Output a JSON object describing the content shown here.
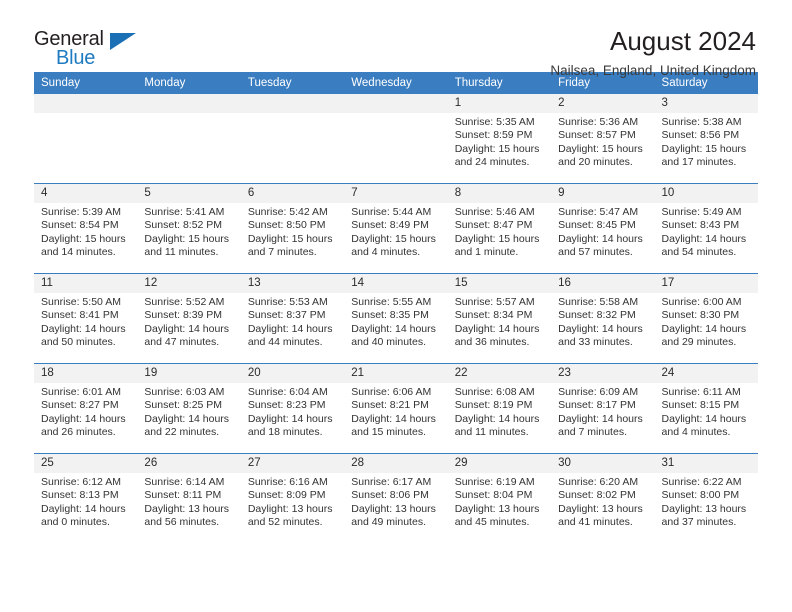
{
  "brand": {
    "name_part1": "General",
    "name_part2": "Blue",
    "logo_icon": "triangle-flag-icon"
  },
  "header": {
    "title": "August 2024",
    "subtitle": "Nailsea, England, United Kingdom"
  },
  "weekday_headers": [
    "Sunday",
    "Monday",
    "Tuesday",
    "Wednesday",
    "Thursday",
    "Friday",
    "Saturday"
  ],
  "colors": {
    "header_blue": "#3a7dc0",
    "brand_blue": "#1f7bc1",
    "daynum_band": "#f2f2f2",
    "text": "#333333"
  },
  "labels": {
    "sunrise_prefix": "Sunrise:",
    "sunset_prefix": "Sunset:",
    "daylight_prefix": "Daylight:"
  },
  "weeks": [
    [
      {
        "day": "",
        "empty": true
      },
      {
        "day": "",
        "empty": true
      },
      {
        "day": "",
        "empty": true
      },
      {
        "day": "",
        "empty": true
      },
      {
        "day": "1",
        "sunrise": "Sunrise: 5:35 AM",
        "sunset": "Sunset: 8:59 PM",
        "daylight_line1": "Daylight: 15 hours",
        "daylight_line2": "and 24 minutes."
      },
      {
        "day": "2",
        "sunrise": "Sunrise: 5:36 AM",
        "sunset": "Sunset: 8:57 PM",
        "daylight_line1": "Daylight: 15 hours",
        "daylight_line2": "and 20 minutes."
      },
      {
        "day": "3",
        "sunrise": "Sunrise: 5:38 AM",
        "sunset": "Sunset: 8:56 PM",
        "daylight_line1": "Daylight: 15 hours",
        "daylight_line2": "and 17 minutes."
      }
    ],
    [
      {
        "day": "4",
        "sunrise": "Sunrise: 5:39 AM",
        "sunset": "Sunset: 8:54 PM",
        "daylight_line1": "Daylight: 15 hours",
        "daylight_line2": "and 14 minutes."
      },
      {
        "day": "5",
        "sunrise": "Sunrise: 5:41 AM",
        "sunset": "Sunset: 8:52 PM",
        "daylight_line1": "Daylight: 15 hours",
        "daylight_line2": "and 11 minutes."
      },
      {
        "day": "6",
        "sunrise": "Sunrise: 5:42 AM",
        "sunset": "Sunset: 8:50 PM",
        "daylight_line1": "Daylight: 15 hours",
        "daylight_line2": "and 7 minutes."
      },
      {
        "day": "7",
        "sunrise": "Sunrise: 5:44 AM",
        "sunset": "Sunset: 8:49 PM",
        "daylight_line1": "Daylight: 15 hours",
        "daylight_line2": "and 4 minutes."
      },
      {
        "day": "8",
        "sunrise": "Sunrise: 5:46 AM",
        "sunset": "Sunset: 8:47 PM",
        "daylight_line1": "Daylight: 15 hours",
        "daylight_line2": "and 1 minute."
      },
      {
        "day": "9",
        "sunrise": "Sunrise: 5:47 AM",
        "sunset": "Sunset: 8:45 PM",
        "daylight_line1": "Daylight: 14 hours",
        "daylight_line2": "and 57 minutes."
      },
      {
        "day": "10",
        "sunrise": "Sunrise: 5:49 AM",
        "sunset": "Sunset: 8:43 PM",
        "daylight_line1": "Daylight: 14 hours",
        "daylight_line2": "and 54 minutes."
      }
    ],
    [
      {
        "day": "11",
        "sunrise": "Sunrise: 5:50 AM",
        "sunset": "Sunset: 8:41 PM",
        "daylight_line1": "Daylight: 14 hours",
        "daylight_line2": "and 50 minutes."
      },
      {
        "day": "12",
        "sunrise": "Sunrise: 5:52 AM",
        "sunset": "Sunset: 8:39 PM",
        "daylight_line1": "Daylight: 14 hours",
        "daylight_line2": "and 47 minutes."
      },
      {
        "day": "13",
        "sunrise": "Sunrise: 5:53 AM",
        "sunset": "Sunset: 8:37 PM",
        "daylight_line1": "Daylight: 14 hours",
        "daylight_line2": "and 44 minutes."
      },
      {
        "day": "14",
        "sunrise": "Sunrise: 5:55 AM",
        "sunset": "Sunset: 8:35 PM",
        "daylight_line1": "Daylight: 14 hours",
        "daylight_line2": "and 40 minutes."
      },
      {
        "day": "15",
        "sunrise": "Sunrise: 5:57 AM",
        "sunset": "Sunset: 8:34 PM",
        "daylight_line1": "Daylight: 14 hours",
        "daylight_line2": "and 36 minutes."
      },
      {
        "day": "16",
        "sunrise": "Sunrise: 5:58 AM",
        "sunset": "Sunset: 8:32 PM",
        "daylight_line1": "Daylight: 14 hours",
        "daylight_line2": "and 33 minutes."
      },
      {
        "day": "17",
        "sunrise": "Sunrise: 6:00 AM",
        "sunset": "Sunset: 8:30 PM",
        "daylight_line1": "Daylight: 14 hours",
        "daylight_line2": "and 29 minutes."
      }
    ],
    [
      {
        "day": "18",
        "sunrise": "Sunrise: 6:01 AM",
        "sunset": "Sunset: 8:27 PM",
        "daylight_line1": "Daylight: 14 hours",
        "daylight_line2": "and 26 minutes."
      },
      {
        "day": "19",
        "sunrise": "Sunrise: 6:03 AM",
        "sunset": "Sunset: 8:25 PM",
        "daylight_line1": "Daylight: 14 hours",
        "daylight_line2": "and 22 minutes."
      },
      {
        "day": "20",
        "sunrise": "Sunrise: 6:04 AM",
        "sunset": "Sunset: 8:23 PM",
        "daylight_line1": "Daylight: 14 hours",
        "daylight_line2": "and 18 minutes."
      },
      {
        "day": "21",
        "sunrise": "Sunrise: 6:06 AM",
        "sunset": "Sunset: 8:21 PM",
        "daylight_line1": "Daylight: 14 hours",
        "daylight_line2": "and 15 minutes."
      },
      {
        "day": "22",
        "sunrise": "Sunrise: 6:08 AM",
        "sunset": "Sunset: 8:19 PM",
        "daylight_line1": "Daylight: 14 hours",
        "daylight_line2": "and 11 minutes."
      },
      {
        "day": "23",
        "sunrise": "Sunrise: 6:09 AM",
        "sunset": "Sunset: 8:17 PM",
        "daylight_line1": "Daylight: 14 hours",
        "daylight_line2": "and 7 minutes."
      },
      {
        "day": "24",
        "sunrise": "Sunrise: 6:11 AM",
        "sunset": "Sunset: 8:15 PM",
        "daylight_line1": "Daylight: 14 hours",
        "daylight_line2": "and 4 minutes."
      }
    ],
    [
      {
        "day": "25",
        "sunrise": "Sunrise: 6:12 AM",
        "sunset": "Sunset: 8:13 PM",
        "daylight_line1": "Daylight: 14 hours",
        "daylight_line2": "and 0 minutes."
      },
      {
        "day": "26",
        "sunrise": "Sunrise: 6:14 AM",
        "sunset": "Sunset: 8:11 PM",
        "daylight_line1": "Daylight: 13 hours",
        "daylight_line2": "and 56 minutes."
      },
      {
        "day": "27",
        "sunrise": "Sunrise: 6:16 AM",
        "sunset": "Sunset: 8:09 PM",
        "daylight_line1": "Daylight: 13 hours",
        "daylight_line2": "and 52 minutes."
      },
      {
        "day": "28",
        "sunrise": "Sunrise: 6:17 AM",
        "sunset": "Sunset: 8:06 PM",
        "daylight_line1": "Daylight: 13 hours",
        "daylight_line2": "and 49 minutes."
      },
      {
        "day": "29",
        "sunrise": "Sunrise: 6:19 AM",
        "sunset": "Sunset: 8:04 PM",
        "daylight_line1": "Daylight: 13 hours",
        "daylight_line2": "and 45 minutes."
      },
      {
        "day": "30",
        "sunrise": "Sunrise: 6:20 AM",
        "sunset": "Sunset: 8:02 PM",
        "daylight_line1": "Daylight: 13 hours",
        "daylight_line2": "and 41 minutes."
      },
      {
        "day": "31",
        "sunrise": "Sunrise: 6:22 AM",
        "sunset": "Sunset: 8:00 PM",
        "daylight_line1": "Daylight: 13 hours",
        "daylight_line2": "and 37 minutes."
      }
    ]
  ]
}
